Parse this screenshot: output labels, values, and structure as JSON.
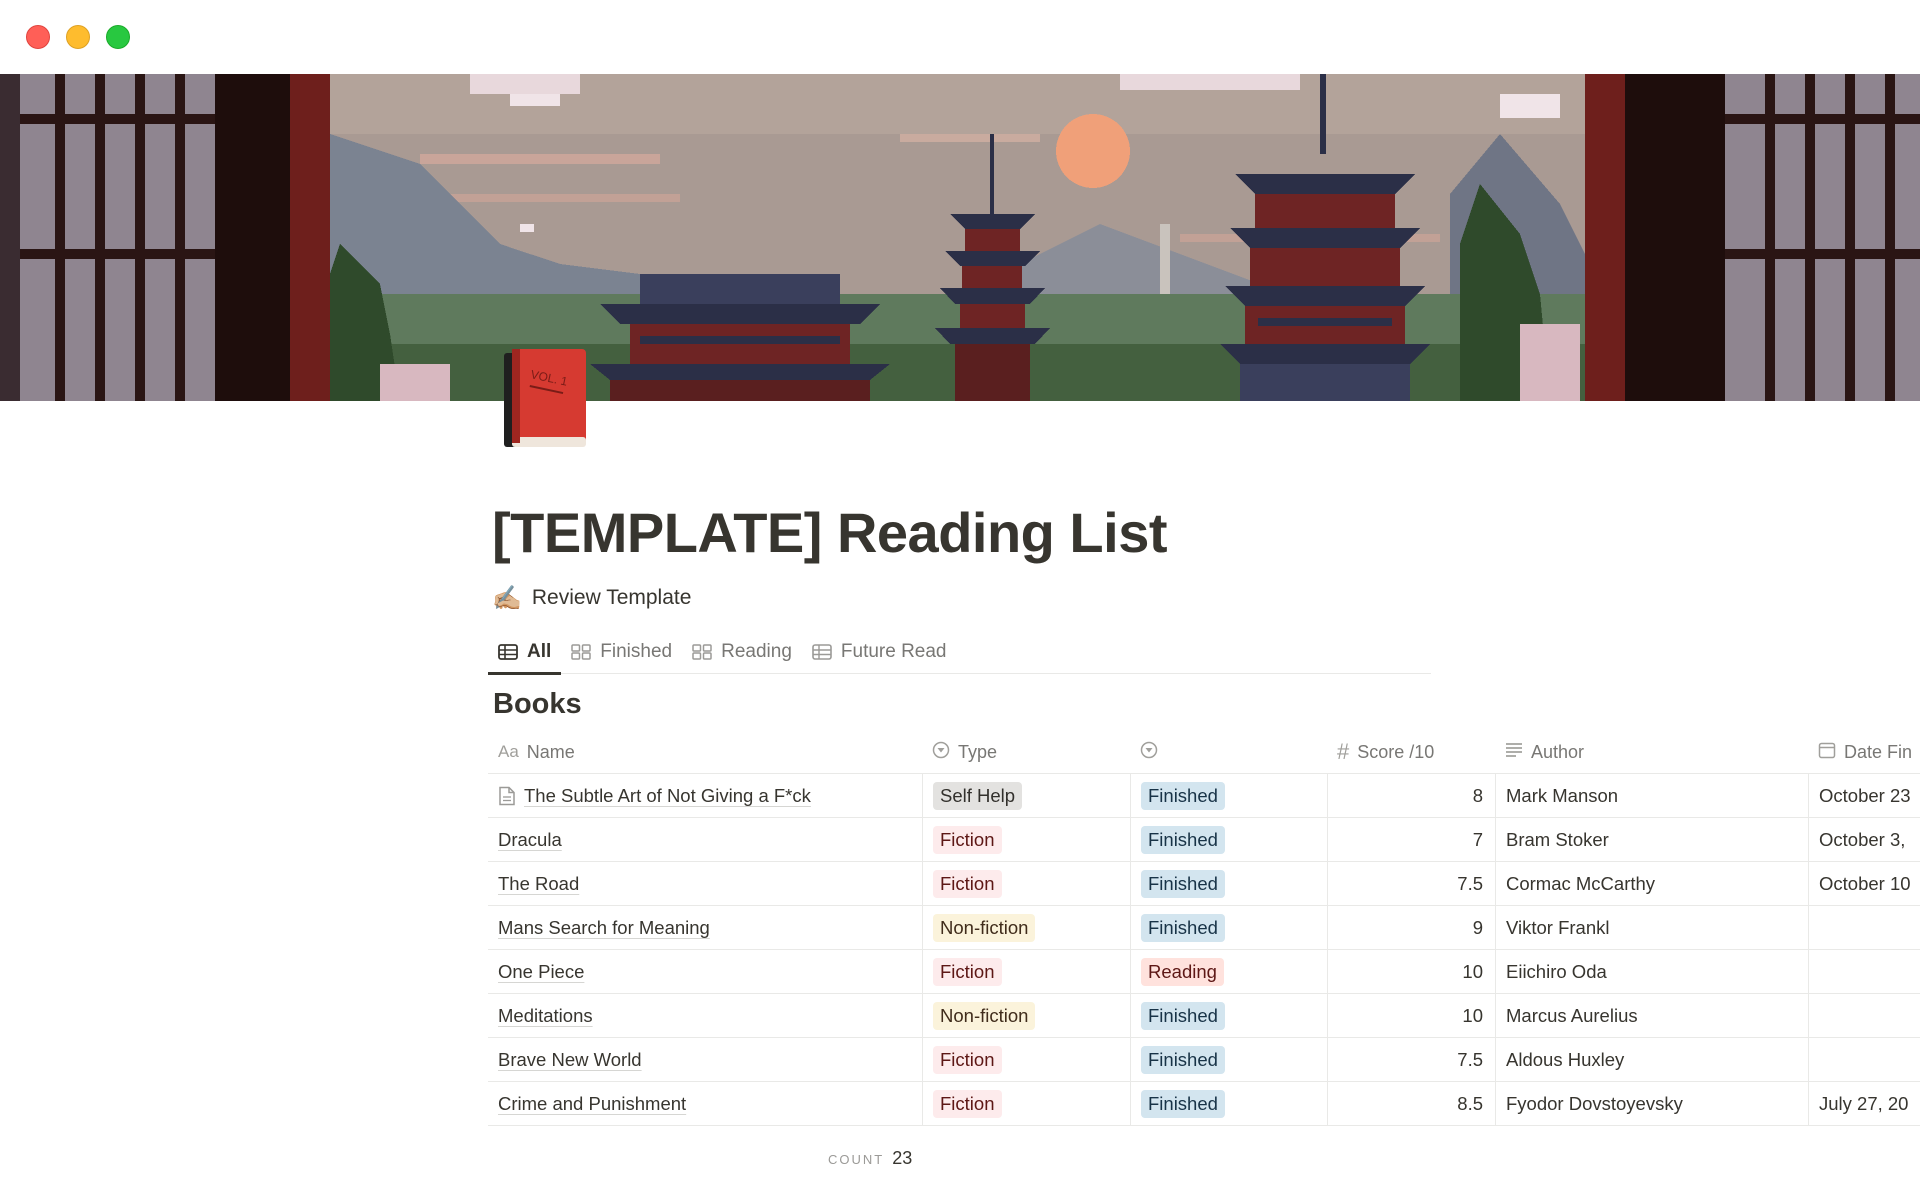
{
  "page": {
    "title": "[TEMPLATE] Reading List",
    "review_link": "Review Template",
    "review_emoji": "✍🏼",
    "icon": "red-book-vol-1",
    "icon_text": "VOL. 1"
  },
  "tabs": [
    {
      "label": "All",
      "icon": "table-icon",
      "active": true
    },
    {
      "label": "Finished",
      "icon": "gallery-icon",
      "active": false
    },
    {
      "label": "Reading",
      "icon": "gallery-icon",
      "active": false
    },
    {
      "label": "Future Read",
      "icon": "table-icon",
      "active": false
    }
  ],
  "database": {
    "title": "Books",
    "columns": [
      {
        "label": "Name",
        "icon": "Aa"
      },
      {
        "label": "Type",
        "icon": "select-icon"
      },
      {
        "label": "",
        "icon": "status-icon"
      },
      {
        "label": "Score /10",
        "icon": "#"
      },
      {
        "label": "Author",
        "icon": "text-icon"
      },
      {
        "label": "Date Fin",
        "icon": "calendar-icon"
      }
    ],
    "rows": [
      {
        "name": "The Subtle Art of Not Giving a F*ck",
        "type": "Self Help",
        "status": "Finished",
        "score": "8",
        "author": "Mark Manson",
        "date": "October 23"
      },
      {
        "name": "Dracula",
        "type": "Fiction",
        "status": "Finished",
        "score": "7",
        "author": "Bram Stoker",
        "date": "October 3,"
      },
      {
        "name": "The Road",
        "type": "Fiction",
        "status": "Finished",
        "score": "7.5",
        "author": "Cormac McCarthy",
        "date": "October 10"
      },
      {
        "name": "Mans Search for Meaning",
        "type": "Non-fiction",
        "status": "Finished",
        "score": "9",
        "author": "Viktor Frankl",
        "date": ""
      },
      {
        "name": "One Piece",
        "type": "Fiction",
        "status": "Reading",
        "score": "10",
        "author": "Eiichiro Oda",
        "date": ""
      },
      {
        "name": "Meditations",
        "type": "Non-fiction",
        "status": "Finished",
        "score": "10",
        "author": "Marcus Aurelius",
        "date": ""
      },
      {
        "name": "Brave New World",
        "type": "Fiction",
        "status": "Finished",
        "score": "7.5",
        "author": "Aldous Huxley",
        "date": ""
      },
      {
        "name": "Crime and Punishment",
        "type": "Fiction",
        "status": "Finished",
        "score": "8.5",
        "author": "Fyodor Dovstoyevsky",
        "date": "July 27, 20"
      }
    ],
    "count_label": "COUNT",
    "count_value": "23"
  },
  "tag_colors": {
    "Self Help": {
      "bg": "#e3e2e0",
      "fg": "#32302c"
    },
    "Fiction": {
      "bg": "#fdebec",
      "fg": "#5d1715"
    },
    "Non-fiction": {
      "bg": "#fbf3db",
      "fg": "#402c1b"
    },
    "Finished": {
      "bg": "#d3e5ef",
      "fg": "#183347"
    },
    "Reading": {
      "bg": "#ffe2dd",
      "fg": "#5d1715"
    }
  }
}
